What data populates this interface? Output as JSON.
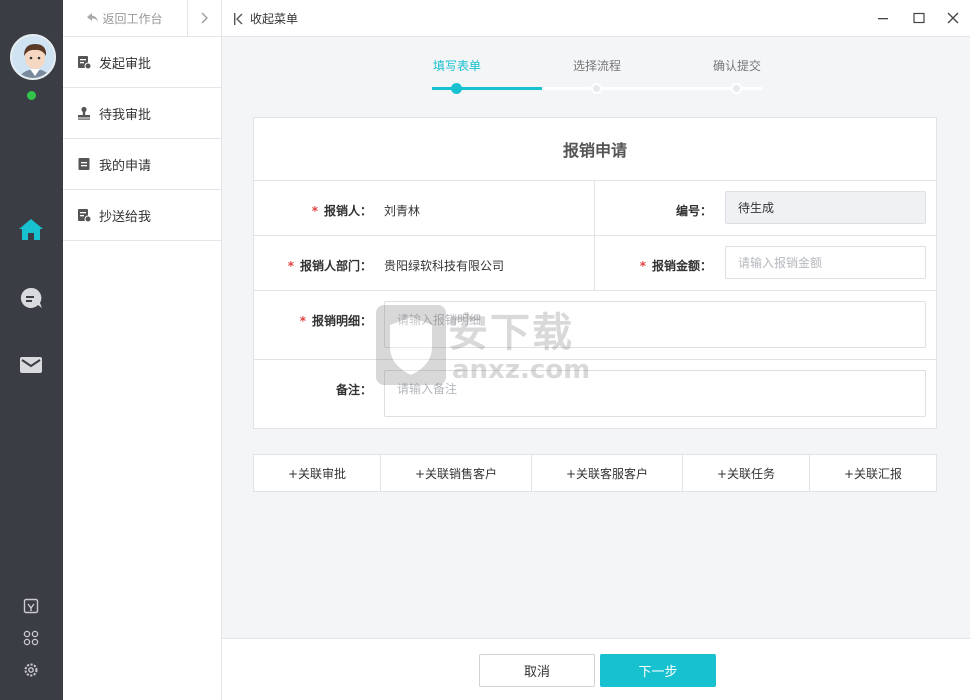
{
  "menu": {
    "back_label": "返回工作台",
    "items": [
      {
        "label": "发起审批",
        "icon": "approval-start-icon"
      },
      {
        "label": "待我审批",
        "icon": "stamp-icon"
      },
      {
        "label": "我的申请",
        "icon": "document-icon"
      },
      {
        "label": "抄送给我",
        "icon": "cc-icon"
      }
    ]
  },
  "topbar": {
    "collapse_label": "收起菜单"
  },
  "steps": [
    {
      "label": "填写表单",
      "active": true
    },
    {
      "label": "选择流程",
      "active": false
    },
    {
      "label": "确认提交",
      "active": false
    }
  ],
  "form": {
    "title": "报销申请",
    "applicant_label": "报销人：",
    "applicant_value": "刘青林",
    "number_label": "编号：",
    "number_value": "待生成",
    "dept_label": "报销人部门：",
    "dept_value": "贵阳绿软科技有限公司",
    "amount_label": "报销金额：",
    "amount_placeholder": "请输入报销金额",
    "detail_label": "报销明细：",
    "detail_placeholder": "请输入报销明细",
    "note_label": "备注：",
    "note_placeholder": "请输入备注",
    "required_mark": "*"
  },
  "links": [
    "+关联审批",
    "+关联销售客户",
    "+关联客服客户",
    "+关联任务",
    "+关联汇报"
  ],
  "buttons": {
    "cancel": "取消",
    "next": "下一步"
  },
  "watermark": {
    "text": "安下载",
    "sub": "anxz.com"
  },
  "colors": {
    "accent": "#18c1cf",
    "rail": "#3a3d44",
    "required": "#e14343",
    "online": "#33c24a"
  }
}
